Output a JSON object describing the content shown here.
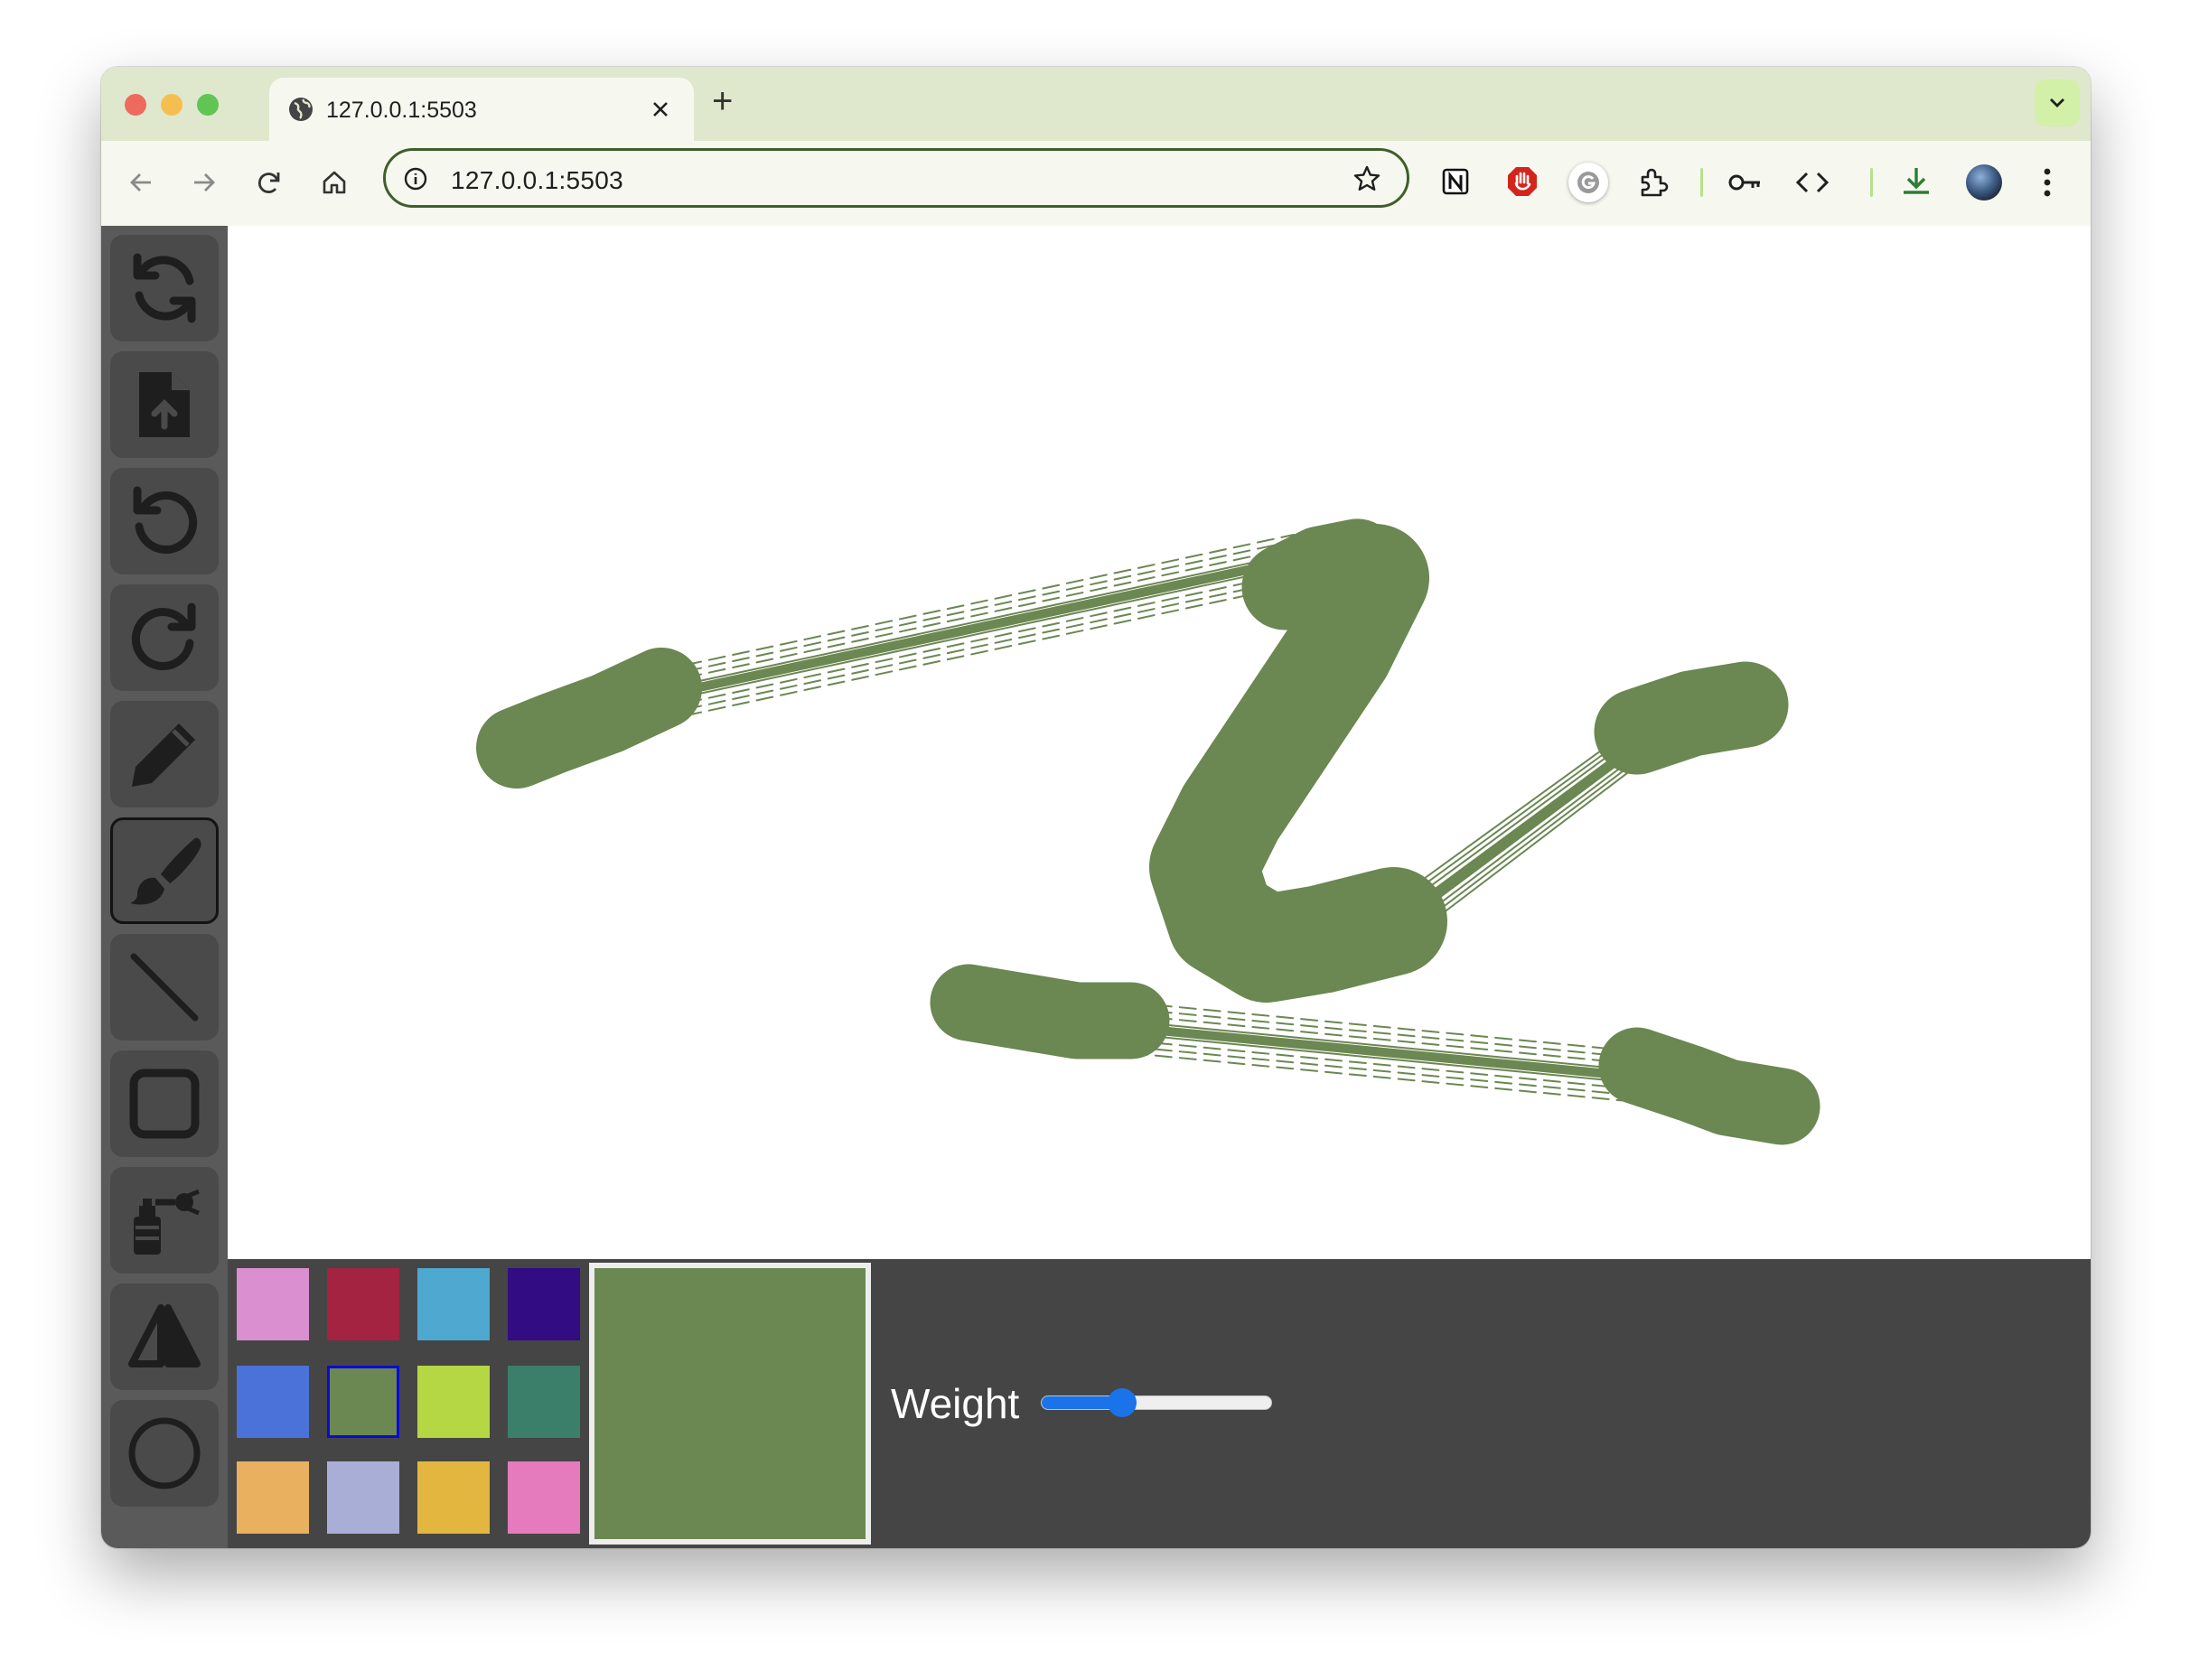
{
  "browser": {
    "tab_title": "127.0.0.1:5503",
    "new_tab_label": "+",
    "url": "127.0.0.1:5503",
    "accent_color": "#3f5f2a"
  },
  "toolbar_icons": [
    "back-icon",
    "forward-icon",
    "reload-icon",
    "home-icon",
    "site-info-icon",
    "bookmark-star-icon",
    "notion-extension-icon",
    "ad-block-extension-icon",
    "grammarly-extension-icon",
    "extensions-puzzle-icon",
    "password-key-icon",
    "developer-code-icon",
    "download-icon",
    "profile-avatar",
    "menu-kebab-icon"
  ],
  "sidebar": {
    "tools": [
      {
        "name": "clear-refresh",
        "icon": "refresh-icon"
      },
      {
        "name": "upload-file",
        "icon": "file-upload-icon"
      },
      {
        "name": "undo",
        "icon": "undo-icon"
      },
      {
        "name": "redo",
        "icon": "redo-icon"
      },
      {
        "name": "pencil",
        "icon": "pencil-icon"
      },
      {
        "name": "brush",
        "icon": "brush-icon",
        "active": true
      },
      {
        "name": "line",
        "icon": "line-icon"
      },
      {
        "name": "rectangle",
        "icon": "square-icon"
      },
      {
        "name": "spray",
        "icon": "spray-can-icon"
      },
      {
        "name": "mirror",
        "icon": "mirror-symmetry-icon"
      },
      {
        "name": "circle",
        "icon": "circle-icon"
      }
    ]
  },
  "palette": {
    "colors": [
      "#d98fd0",
      "#a32340",
      "#4ea8cf",
      "#310c83",
      "#4a72d8",
      "#6b8752",
      "#b5d743",
      "#3b7e6a",
      "#e9b05f",
      "#a9aed6",
      "#e3b73f",
      "#e57bbd"
    ],
    "selected_index": 5,
    "current_color": "#6b8752"
  },
  "weight": {
    "label": "Weight",
    "value_fraction": 0.35
  },
  "drawing": {
    "stroke_color": "#6b8752"
  }
}
